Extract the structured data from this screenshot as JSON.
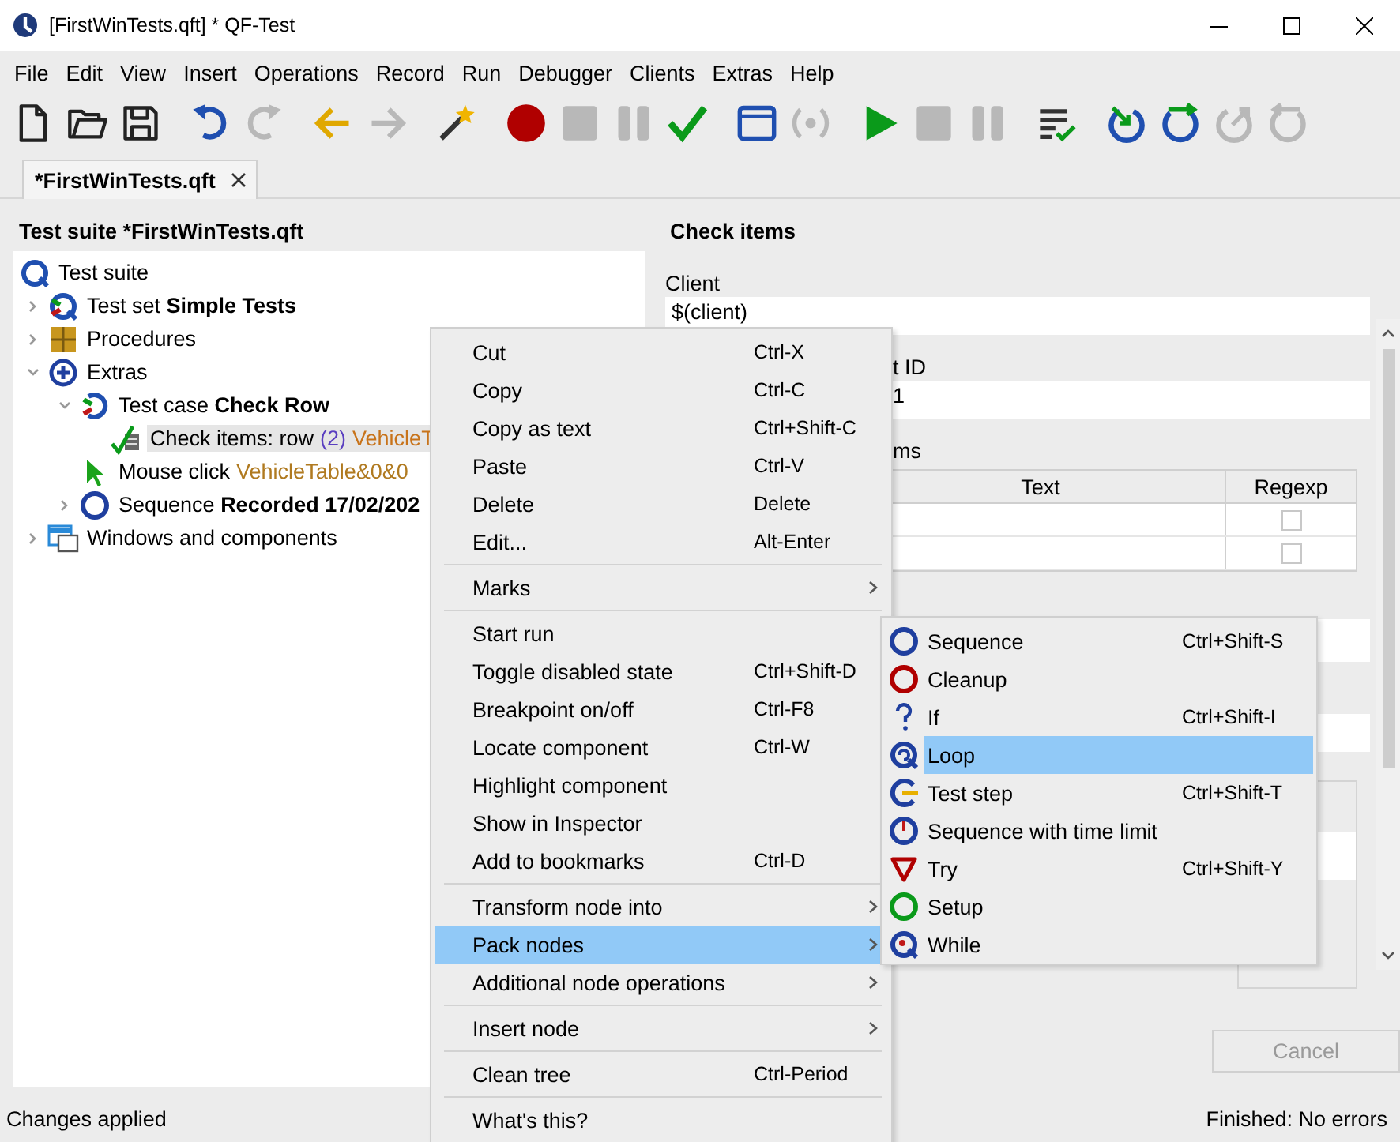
{
  "window": {
    "title": "[FirstWinTests.qft] * QF-Test"
  },
  "menu_bar": [
    "File",
    "Edit",
    "View",
    "Insert",
    "Operations",
    "Record",
    "Run",
    "Debugger",
    "Clients",
    "Extras",
    "Help"
  ],
  "toolbar": [
    [
      {
        "kind": "new-file",
        "disabled": false
      },
      {
        "kind": "open-folder",
        "disabled": false
      },
      {
        "kind": "save",
        "disabled": false
      }
    ],
    [
      {
        "kind": "undo",
        "disabled": false
      },
      {
        "kind": "redo",
        "disabled": true
      }
    ],
    [
      {
        "kind": "back",
        "disabled": false
      },
      {
        "kind": "forward",
        "disabled": true
      }
    ],
    [
      {
        "kind": "wand",
        "disabled": false
      }
    ],
    [
      {
        "kind": "record",
        "disabled": false
      },
      {
        "kind": "stop",
        "disabled": true
      },
      {
        "kind": "pause",
        "disabled": true
      },
      {
        "kind": "check",
        "disabled": false
      }
    ],
    [
      {
        "kind": "window",
        "disabled": false
      },
      {
        "kind": "signal",
        "disabled": true
      }
    ],
    [
      {
        "kind": "play",
        "disabled": false
      },
      {
        "kind": "stop",
        "disabled": true
      },
      {
        "kind": "pause",
        "disabled": true
      }
    ],
    [
      {
        "kind": "list-check",
        "disabled": false
      }
    ],
    [
      {
        "kind": "step-in",
        "disabled": false
      },
      {
        "kind": "step-over",
        "disabled": false
      },
      {
        "kind": "step-out",
        "disabled": true
      },
      {
        "kind": "loop-back",
        "disabled": true
      }
    ]
  ],
  "tabs": [
    {
      "label": "*FirstWinTests.qft",
      "selected": true
    }
  ],
  "tree": {
    "title": "Test suite *FirstWinTests.qft",
    "root": {
      "kind": "suite",
      "label": "Test suite",
      "selected": false,
      "children": [
        {
          "kind": "testset",
          "label": "Test set **Simple Tests**",
          "expanded": false,
          "selected": false
        },
        {
          "kind": "procedures",
          "label": "Procedures",
          "expanded": false,
          "selected": false
        },
        {
          "kind": "extras",
          "label": "Extras",
          "expanded": true,
          "selected": false,
          "children": [
            {
              "kind": "testcase",
              "label": "Test case **Check Row**",
              "expanded": true,
              "selected": false,
              "children": [
                {
                  "kind": "check",
                  "label": "Check items: row",
                  "count": "(2)",
                  "target": "VehicleT",
                  "selected": true
                }
              ]
            },
            {
              "kind": "mouse",
              "label": "Mouse click",
              "target": "VehicleTable&0&0",
              "selected": false
            },
            {
              "kind": "sequence",
              "label": "Sequence **Recorded 17/02/202**",
              "expanded": false,
              "selected": false
            }
          ]
        },
        {
          "kind": "windows",
          "label": "Windows and components",
          "expanded": false,
          "selected": false
        }
      ]
    }
  },
  "detail": {
    "title": "Check items",
    "fields": [
      {
        "label": "Client",
        "value": "$(client)"
      },
      {
        "label": "t ID",
        "value": "1"
      }
    ],
    "table": {
      "label": "ms",
      "columns": [
        "Text",
        "Regexp"
      ],
      "rows": [
        {
          "checked": false
        },
        {
          "checked": false
        }
      ]
    },
    "cancel": {
      "label": "Cancel",
      "disabled": true
    }
  },
  "context_menu": {
    "sections": [
      [
        {
          "label": "Cut",
          "shortcut": "Ctrl-X",
          "submenu": false,
          "selected": false
        },
        {
          "label": "Copy",
          "shortcut": "Ctrl-C",
          "submenu": false,
          "selected": false
        },
        {
          "label": "Copy as text",
          "shortcut": "Ctrl+Shift-C",
          "submenu": false,
          "selected": false
        },
        {
          "label": "Paste",
          "shortcut": "Ctrl-V",
          "submenu": false,
          "selected": false
        },
        {
          "label": "Delete",
          "shortcut": "Delete",
          "submenu": false,
          "selected": false
        },
        {
          "label": "Edit...",
          "shortcut": "Alt-Enter",
          "submenu": false,
          "selected": false
        }
      ],
      [
        {
          "label": "Marks",
          "submenu": true,
          "selected": false
        }
      ],
      [
        {
          "label": "Start run",
          "submenu": false,
          "selected": false
        },
        {
          "label": "Toggle disabled state",
          "shortcut": "Ctrl+Shift-D",
          "submenu": false,
          "selected": false
        },
        {
          "label": "Breakpoint on/off",
          "shortcut": "Ctrl-F8",
          "submenu": false,
          "selected": false
        },
        {
          "label": "Locate component",
          "shortcut": "Ctrl-W",
          "submenu": false,
          "selected": false
        },
        {
          "label": "Highlight component",
          "submenu": false,
          "selected": false
        },
        {
          "label": "Show in Inspector",
          "submenu": false,
          "selected": false
        },
        {
          "label": "Add to bookmarks",
          "shortcut": "Ctrl-D",
          "submenu": false,
          "selected": false
        }
      ],
      [
        {
          "label": "Transform node into",
          "submenu": true,
          "selected": false
        },
        {
          "label": "Pack nodes",
          "submenu": true,
          "selected": true
        },
        {
          "label": "Additional node operations",
          "submenu": true,
          "selected": false
        }
      ],
      [
        {
          "label": "Insert node",
          "submenu": true,
          "selected": false
        }
      ],
      [
        {
          "label": "Clean tree",
          "shortcut": "Ctrl-Period",
          "submenu": false,
          "selected": false
        }
      ],
      [
        {
          "label": "What's this?",
          "submenu": false,
          "selected": false
        }
      ]
    ]
  },
  "submenu": [
    {
      "kind": "sequence",
      "label": "Sequence",
      "shortcut": "Ctrl+Shift-S",
      "selected": false
    },
    {
      "kind": "cleanup",
      "label": "Cleanup",
      "selected": false
    },
    {
      "kind": "if",
      "label": "If",
      "shortcut": "Ctrl+Shift-I",
      "selected": false
    },
    {
      "kind": "loop",
      "label": "Loop",
      "selected": true
    },
    {
      "kind": "teststep",
      "label": "Test step",
      "shortcut": "Ctrl+Shift-T",
      "selected": false
    },
    {
      "kind": "timelimit",
      "label": "Sequence with time limit",
      "selected": false
    },
    {
      "kind": "try",
      "label": "Try",
      "shortcut": "Ctrl+Shift-Y",
      "selected": false
    },
    {
      "kind": "setup",
      "label": "Setup",
      "selected": false
    },
    {
      "kind": "while",
      "label": "While",
      "selected": false
    }
  ],
  "status_bar": {
    "left": "Changes applied",
    "right": "Finished: No errors"
  }
}
